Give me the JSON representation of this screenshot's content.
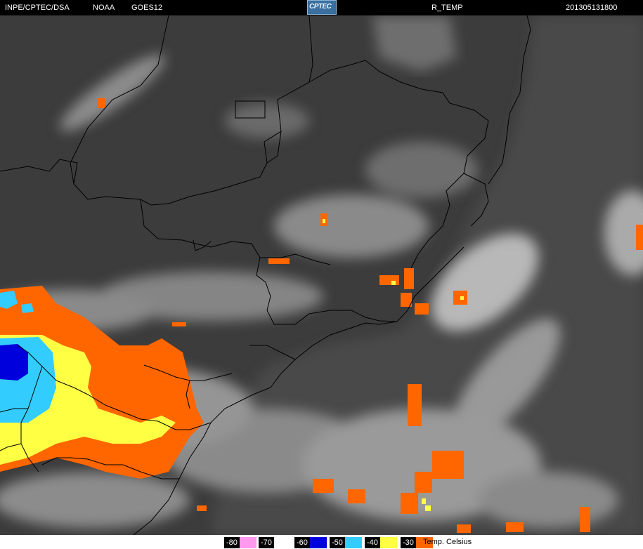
{
  "header": {
    "source": "INPE/CPTEC/DSA",
    "agency": "NOAA",
    "satellite": "GOES12",
    "logo_text": "CPTEC",
    "product": "R_TEMP",
    "timestamp": "201305131800"
  },
  "legend": {
    "items": [
      {
        "label": "-80",
        "color": "#ff99ee"
      },
      {
        "label": "-70",
        "color": "#ffffff"
      },
      {
        "label": "-60",
        "color": "#0000dd"
      },
      {
        "label": "-50",
        "color": "#33ccff"
      },
      {
        "label": "-40",
        "color": "#ffff44"
      },
      {
        "label": "-30",
        "color": "#ff6600"
      }
    ],
    "unit": "Temp. Celsius"
  },
  "colors": {
    "background": "#3a3a3a",
    "cloud": "#c8c8c8",
    "border": "#000000"
  }
}
